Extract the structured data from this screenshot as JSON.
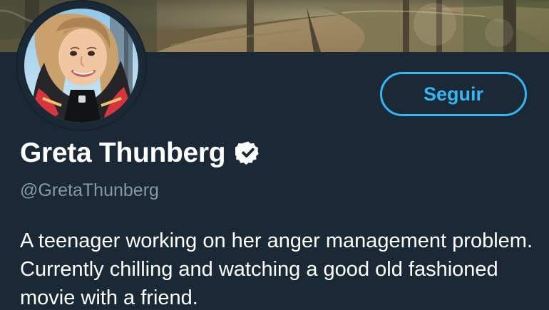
{
  "profile": {
    "display_name": "Greta Thunberg",
    "handle": "@GretaThunberg",
    "follow_label": "Seguir",
    "bio": "A teenager working on her anger management problem. Currently chilling and watching a good old fashioned movie with a friend."
  },
  "colors": {
    "background": "#1b2836",
    "accent": "#33b6f2",
    "text_primary": "#ffffff",
    "text_secondary": "#8798a8",
    "verified_badge": "#ffffff"
  },
  "icons": {
    "verified": "verified-badge-icon"
  }
}
